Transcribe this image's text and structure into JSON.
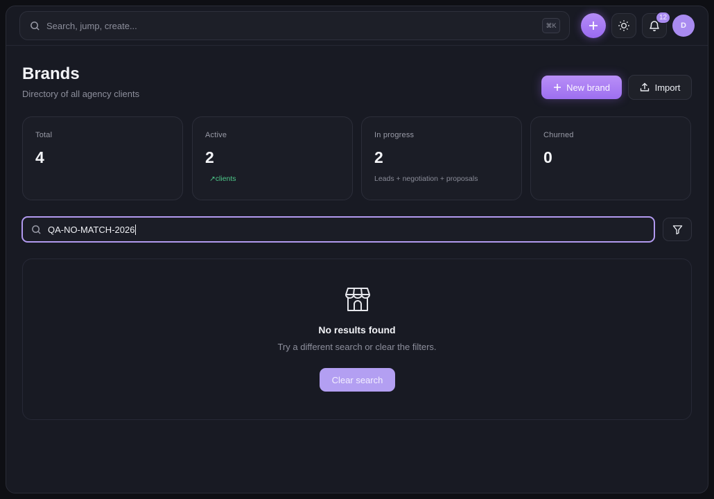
{
  "topbar": {
    "search_placeholder": "Search, jump, create...",
    "shortcut": "⌘K",
    "notification_count": "12",
    "avatar_initial": "D"
  },
  "header": {
    "title": "Brands",
    "subtitle": "Directory of all agency clients",
    "new_brand_label": "New brand",
    "import_label": "Import"
  },
  "stats": [
    {
      "label": "Total",
      "value": "4",
      "note": ""
    },
    {
      "label": "Active",
      "value": "2",
      "note": "↗clients"
    },
    {
      "label": "In progress",
      "value": "2",
      "note": "Leads + negotiation + proposals"
    },
    {
      "label": "Churned",
      "value": "0",
      "note": ""
    }
  ],
  "filter": {
    "query": "QA-NO-MATCH-2026"
  },
  "empty_state": {
    "title": "No results found",
    "subtitle": "Try a different search or clear the filters.",
    "clear_label": "Clear search"
  },
  "colors": {
    "accent": "#a98bf0",
    "positive": "#4ec98a",
    "background": "#181a23"
  },
  "icons": [
    "search-icon",
    "plus-icon",
    "sun-icon",
    "bell-icon",
    "upload-icon",
    "filter-icon",
    "store-icon"
  ]
}
